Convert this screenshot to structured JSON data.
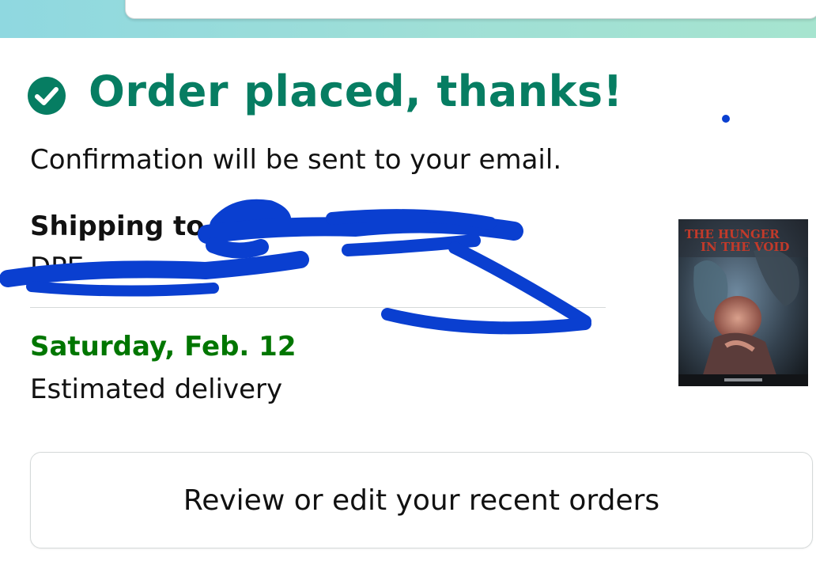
{
  "header": {
    "title": "Order placed, thanks!",
    "subtitle": "Confirmation will be sent to your email."
  },
  "shipping": {
    "label": "Shipping to",
    "address_visible_fragment": "DPE"
  },
  "delivery": {
    "date": "Saturday, Feb. 12",
    "label": "Estimated delivery"
  },
  "product": {
    "cover_title": "THE HUNGER IN THE VOID",
    "icon": "book-cover-image"
  },
  "actions": {
    "review_orders_label": "Review or edit your recent orders"
  },
  "colors": {
    "success_green": "#067D62",
    "delivery_green": "#007600",
    "redaction_blue": "#0a3fd0",
    "top_band": "#98dcd9"
  }
}
